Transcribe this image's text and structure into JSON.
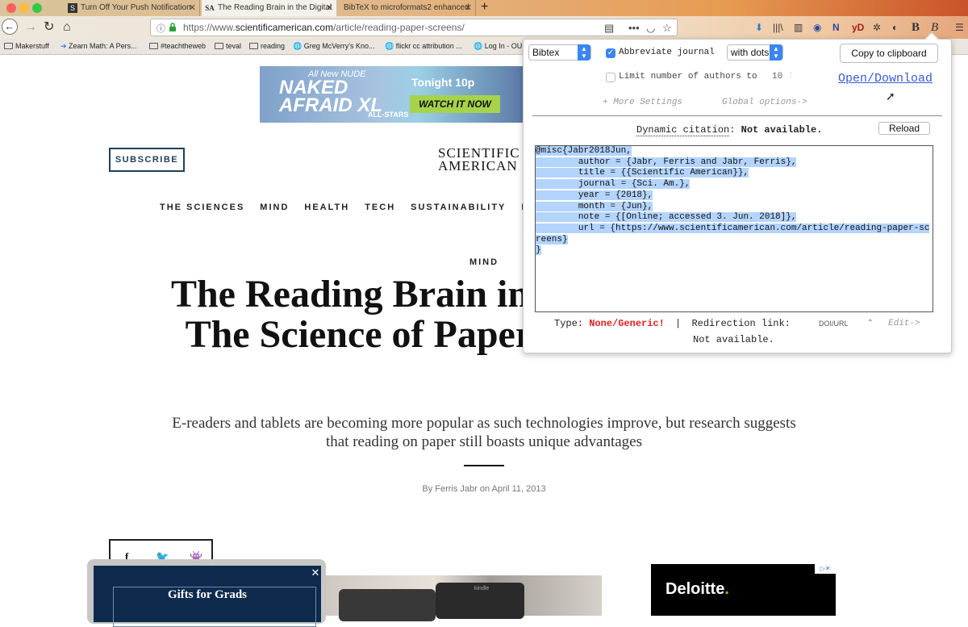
{
  "browser": {
    "tabs": [
      {
        "title": "Turn Off Your Push Notification",
        "favicon": "S"
      },
      {
        "title": "The Reading Brain in the Digital",
        "favicon": "SA"
      },
      {
        "title": "BibTeX to microformats2 enhanced",
        "favicon": ""
      }
    ],
    "url_host": "https://www.",
    "url_domain": "scientificamerican.com",
    "url_path": "/article/reading-paper-screens/",
    "toolbar_icons": [
      "download-icon",
      "library-icon",
      "sidebar-icon",
      "extension-icon",
      "n-icon",
      "yd-icon",
      "settings-icon",
      "extension-icon",
      "lock-icon",
      "bold-b-icon",
      "bibtex-icon",
      "menu-icon"
    ],
    "bookmarks": [
      "Makerstuff",
      "Zearn Math: A Pers...",
      "#teachtheweb",
      "teval",
      "reading",
      "Greg McVerry's Kno...",
      "flickr cc attribution ...",
      "Log In - OU"
    ]
  },
  "page": {
    "ad": {
      "line1": "All New NUDE",
      "line2": "NAKED AFRAID XL",
      "line3": "Tonight 10p",
      "cta": "WATCH IT NOW",
      "line4": "ALL-STARS"
    },
    "subscribe": "SUBSCRIBE",
    "logo_line1": "SCIENTIFIC",
    "logo_line2": "AMERICAN",
    "nav": [
      "THE SCIENCES",
      "MIND",
      "HEALTH",
      "TECH",
      "SUSTAINABILITY",
      "E"
    ],
    "section": "MIND",
    "headline": "The Reading Brain in the Digital Age: The Science of Paper versus Screens",
    "dek": "E-readers and tablets are becoming more popular as such technologies improve, but research suggests that reading on paper still boasts unique advantages",
    "byline": "By Ferris Jabr on April 11, 2013",
    "gifts_title": "Gifts for Grads",
    "kindle_label": "kindle",
    "deloitte": "Deloitte",
    "deloitte_dot": "."
  },
  "popup": {
    "format": "Bibtex",
    "abbreviate_label": "Abbreviate journal",
    "abbreviate_option": "with dots",
    "limit_label": "Limit number of authors to",
    "limit_value": "10",
    "copy_button": "Copy to clipboard",
    "open_download": "Open/Download",
    "more_settings": "+ More Settings",
    "global_options": "Global options->",
    "dynamic_label": "Dynamic citation",
    "dynamic_colon": ":",
    "dynamic_status": "Not available.",
    "reload_button": "Reload",
    "bibtex": "@misc{Jabr2018Jun,\n        author = {Jabr, Ferris and Jabr, Ferris},\n        title = {{Scientific American}},\n        journal = {Sci. Am.},\n        year = {2018},\n        month = {Jun},\n        note = {[Online; accessed 3. Jun. 2018]},\n        url = {https://www.scientificamerican.com/article/reading-paper-screens}\n}",
    "type_label": "Type:",
    "type_value": "None/Generic!",
    "sep": "|",
    "redirection_label": "Redirection link:",
    "redirection_option": "DOI/URL",
    "edit_link": "Edit->",
    "redirection_status": "Not available."
  },
  "colors": {
    "accent": "#3b86f0",
    "error": "#e02020",
    "brand_navy": "#1e3f5a",
    "selection": "#b3d4fd"
  }
}
